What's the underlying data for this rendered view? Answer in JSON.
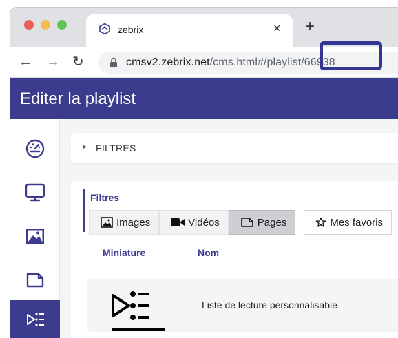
{
  "browser": {
    "tab_title": "zebrix",
    "tab_close": "×",
    "new_tab": "+",
    "url_host": "cmsv2.zebrix.net",
    "url_path": "/cms.html#/playlist/66938"
  },
  "app": {
    "title": "Editer la playlist"
  },
  "sidebar": {
    "items": [
      {
        "icon": "dashboard-icon"
      },
      {
        "icon": "monitor-icon"
      },
      {
        "icon": "image-icon"
      },
      {
        "icon": "page-icon"
      },
      {
        "icon": "playlist-icon",
        "active": true
      }
    ]
  },
  "filters_toggle": {
    "caret": "▸",
    "label": "FILTRES"
  },
  "filters": {
    "title": "Filtres",
    "buttons": [
      {
        "label": "Images",
        "icon": "image-icon"
      },
      {
        "label": "Vidéos",
        "icon": "video-icon"
      },
      {
        "label": "Pages",
        "icon": "page-icon",
        "active": true
      },
      {
        "label": "Mes favoris",
        "icon": "star-icon"
      }
    ]
  },
  "table": {
    "headers": {
      "thumbnail": "Miniature",
      "name": "Nom"
    },
    "rows": [
      {
        "name": "Liste de lecture personnalisable",
        "icon": "custom-playlist-icon"
      }
    ]
  },
  "colors": {
    "brand": "#3c3c8e",
    "highlight": "#353592"
  }
}
